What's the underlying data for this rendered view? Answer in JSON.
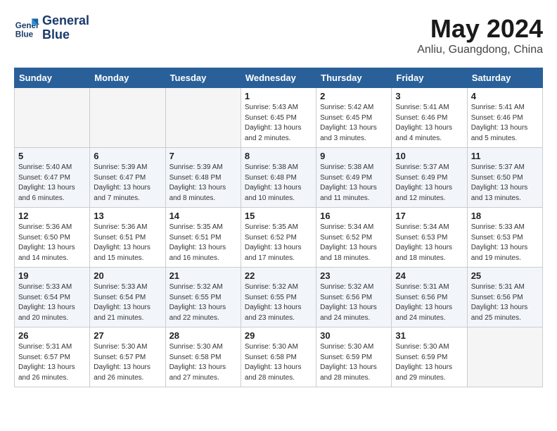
{
  "header": {
    "logo_line1": "General",
    "logo_line2": "Blue",
    "month": "May 2024",
    "location": "Anliu, Guangdong, China"
  },
  "weekdays": [
    "Sunday",
    "Monday",
    "Tuesday",
    "Wednesday",
    "Thursday",
    "Friday",
    "Saturday"
  ],
  "weeks": [
    [
      {
        "day": "",
        "empty": true
      },
      {
        "day": "",
        "empty": true
      },
      {
        "day": "",
        "empty": true
      },
      {
        "day": "1",
        "sunrise": "5:43 AM",
        "sunset": "6:45 PM",
        "daylight": "13 hours and 2 minutes."
      },
      {
        "day": "2",
        "sunrise": "5:42 AM",
        "sunset": "6:45 PM",
        "daylight": "13 hours and 3 minutes."
      },
      {
        "day": "3",
        "sunrise": "5:41 AM",
        "sunset": "6:46 PM",
        "daylight": "13 hours and 4 minutes."
      },
      {
        "day": "4",
        "sunrise": "5:41 AM",
        "sunset": "6:46 PM",
        "daylight": "13 hours and 5 minutes."
      }
    ],
    [
      {
        "day": "5",
        "sunrise": "5:40 AM",
        "sunset": "6:47 PM",
        "daylight": "13 hours and 6 minutes."
      },
      {
        "day": "6",
        "sunrise": "5:39 AM",
        "sunset": "6:47 PM",
        "daylight": "13 hours and 7 minutes."
      },
      {
        "day": "7",
        "sunrise": "5:39 AM",
        "sunset": "6:48 PM",
        "daylight": "13 hours and 8 minutes."
      },
      {
        "day": "8",
        "sunrise": "5:38 AM",
        "sunset": "6:48 PM",
        "daylight": "13 hours and 10 minutes."
      },
      {
        "day": "9",
        "sunrise": "5:38 AM",
        "sunset": "6:49 PM",
        "daylight": "13 hours and 11 minutes."
      },
      {
        "day": "10",
        "sunrise": "5:37 AM",
        "sunset": "6:49 PM",
        "daylight": "13 hours and 12 minutes."
      },
      {
        "day": "11",
        "sunrise": "5:37 AM",
        "sunset": "6:50 PM",
        "daylight": "13 hours and 13 minutes."
      }
    ],
    [
      {
        "day": "12",
        "sunrise": "5:36 AM",
        "sunset": "6:50 PM",
        "daylight": "13 hours and 14 minutes."
      },
      {
        "day": "13",
        "sunrise": "5:36 AM",
        "sunset": "6:51 PM",
        "daylight": "13 hours and 15 minutes."
      },
      {
        "day": "14",
        "sunrise": "5:35 AM",
        "sunset": "6:51 PM",
        "daylight": "13 hours and 16 minutes."
      },
      {
        "day": "15",
        "sunrise": "5:35 AM",
        "sunset": "6:52 PM",
        "daylight": "13 hours and 17 minutes."
      },
      {
        "day": "16",
        "sunrise": "5:34 AM",
        "sunset": "6:52 PM",
        "daylight": "13 hours and 18 minutes."
      },
      {
        "day": "17",
        "sunrise": "5:34 AM",
        "sunset": "6:53 PM",
        "daylight": "13 hours and 18 minutes."
      },
      {
        "day": "18",
        "sunrise": "5:33 AM",
        "sunset": "6:53 PM",
        "daylight": "13 hours and 19 minutes."
      }
    ],
    [
      {
        "day": "19",
        "sunrise": "5:33 AM",
        "sunset": "6:54 PM",
        "daylight": "13 hours and 20 minutes."
      },
      {
        "day": "20",
        "sunrise": "5:33 AM",
        "sunset": "6:54 PM",
        "daylight": "13 hours and 21 minutes."
      },
      {
        "day": "21",
        "sunrise": "5:32 AM",
        "sunset": "6:55 PM",
        "daylight": "13 hours and 22 minutes."
      },
      {
        "day": "22",
        "sunrise": "5:32 AM",
        "sunset": "6:55 PM",
        "daylight": "13 hours and 23 minutes."
      },
      {
        "day": "23",
        "sunrise": "5:32 AM",
        "sunset": "6:56 PM",
        "daylight": "13 hours and 24 minutes."
      },
      {
        "day": "24",
        "sunrise": "5:31 AM",
        "sunset": "6:56 PM",
        "daylight": "13 hours and 24 minutes."
      },
      {
        "day": "25",
        "sunrise": "5:31 AM",
        "sunset": "6:56 PM",
        "daylight": "13 hours and 25 minutes."
      }
    ],
    [
      {
        "day": "26",
        "sunrise": "5:31 AM",
        "sunset": "6:57 PM",
        "daylight": "13 hours and 26 minutes."
      },
      {
        "day": "27",
        "sunrise": "5:30 AM",
        "sunset": "6:57 PM",
        "daylight": "13 hours and 26 minutes."
      },
      {
        "day": "28",
        "sunrise": "5:30 AM",
        "sunset": "6:58 PM",
        "daylight": "13 hours and 27 minutes."
      },
      {
        "day": "29",
        "sunrise": "5:30 AM",
        "sunset": "6:58 PM",
        "daylight": "13 hours and 28 minutes."
      },
      {
        "day": "30",
        "sunrise": "5:30 AM",
        "sunset": "6:59 PM",
        "daylight": "13 hours and 28 minutes."
      },
      {
        "day": "31",
        "sunrise": "5:30 AM",
        "sunset": "6:59 PM",
        "daylight": "13 hours and 29 minutes."
      },
      {
        "day": "",
        "empty": true
      }
    ]
  ]
}
